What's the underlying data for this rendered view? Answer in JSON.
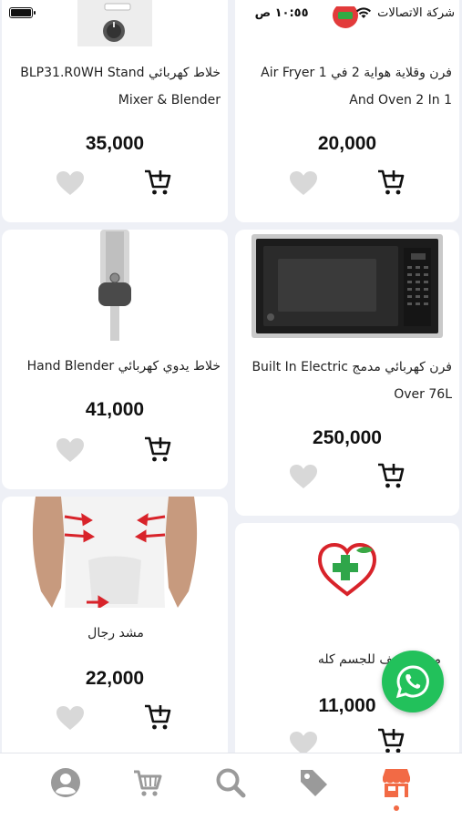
{
  "status_bar": {
    "carrier": "شركة الاتصالات",
    "time": "١٠:٥٥ ص"
  },
  "products": [
    {
      "title": "فرن وقلاية هواية 2 في 1 Air Fryer And Oven 2 In 1",
      "price": "20,000",
      "image_icon": "air-fryer-image"
    },
    {
      "title": "خلاط كهربائي BLP31.R0WH Stand Mixer & Blender",
      "price": "35,000",
      "image_icon": "stand-mixer-image"
    },
    {
      "title": "فرن كهربائي مدمج Built In Electric Over 76L",
      "price": "250,000",
      "image_icon": "microwave-oven-image"
    },
    {
      "title": "خلاط يدوي كهربائي Hand Blender",
      "price": "41,000",
      "image_icon": "hand-blender-image"
    },
    {
      "title": "مشد تنحيف للجسم كله",
      "price": "11,000",
      "image_icon": "health-heart-logo-image"
    },
    {
      "title": "مشد رجال",
      "price": "22,000",
      "image_icon": "mens-shaper-image"
    }
  ],
  "bottom_nav": {
    "items": [
      "profile-icon",
      "cart-icon",
      "search-icon",
      "tag-icon",
      "store-icon"
    ],
    "active": "store-icon"
  },
  "colors": {
    "accent": "#f26a45",
    "whatsapp": "#22c15b",
    "heart": "#d8d8d8",
    "nav_icon": "#9a9a9a",
    "background": "#eef0f6"
  }
}
